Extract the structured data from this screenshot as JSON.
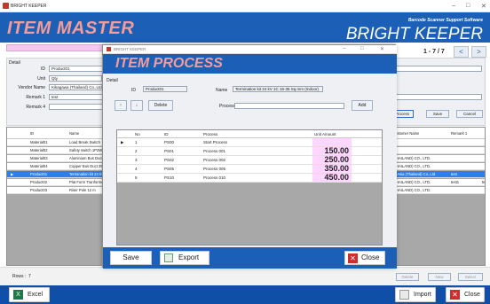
{
  "window": {
    "title": "BRIGHT KEEPER",
    "minimize": "–",
    "maximize": "□",
    "close": "✕"
  },
  "banner": {
    "title": "ITEM MASTER",
    "tagline": "Barcode Scanner Support Software",
    "brand": "BRIGHT KEEPER"
  },
  "detail": {
    "section": "Detail",
    "id_label": "ID",
    "id_value": "Product01",
    "unit_label": "Unit",
    "unit_value": "Qty",
    "vendor_label": "Vendor Name",
    "vendor_value": "Kikagawa (Thailand) Co.,Ltd.",
    "remark1_label": "Remark 1",
    "remark1_value": "test",
    "remark2_label": "Remark 4",
    "remark2_value": ""
  },
  "pager": {
    "text": "1 - 7 / 7",
    "prev": "<",
    "next": ">"
  },
  "actions": {
    "process": "Process",
    "save": "Save",
    "cancel": "Cancel"
  },
  "grid": {
    "headers": {
      "id": "ID",
      "name": "Name",
      "customer": "Customer Name",
      "remark": "Remark 1"
    },
    "rows": [
      {
        "id": "Material01",
        "name": "Load Break Switch",
        "customer": "",
        "remark": "",
        "extra": ""
      },
      {
        "id": "Material02",
        "name": "Safety switch 1P2W 4",
        "customer": "",
        "remark": "",
        "extra": ""
      },
      {
        "id": "Material03",
        "name": "Aluminium Bus Duct 3(",
        "customer": "(THAILAND) CO., LTD.",
        "remark": "",
        "extra": ""
      },
      {
        "id": "Material04",
        "name": "Copper Bus Duct 2500",
        "customer": "(THAILAND) CO., LTD.",
        "remark": "",
        "extra": ""
      },
      {
        "id": "Product01",
        "name": "Termination kit 24 kV",
        "customer": "ch Asia (Thailand) Co.,Ltd.",
        "remark": "test",
        "extra": ""
      },
      {
        "id": "Product02",
        "name": "Plat Form Tranformer 1",
        "customer": "(THAILAND) CO., LTD.",
        "remark": "test1",
        "extra": "te"
      },
      {
        "id": "Product03",
        "name": "Riser Pole 12 m",
        "customer": "(THAILAND) CO., LTD.",
        "remark": "",
        "extra": ""
      }
    ],
    "selected_index": 4
  },
  "status": {
    "rows_label": "Rows :",
    "rows_value": "7",
    "delete": "Delete",
    "new": "New",
    "select": "Select"
  },
  "bottom": {
    "excel": "Excel",
    "import": "Import",
    "close": "Close"
  },
  "modal": {
    "title": "BRIGHT KEEPER",
    "banner": "ITEM PROCESS",
    "section": "Detail",
    "id_label": "ID",
    "id_value": "Product01",
    "name_label": "Name",
    "name_value": "Termination kit 24 kV 1C 16-35 Sq.mm (Indoor)",
    "up": "↑",
    "down": "↓",
    "delete": "Delete",
    "process_label": "Process",
    "process_value": "",
    "add": "Add",
    "headers": {
      "no": "No",
      "id": "ID",
      "process": "Process",
      "amount": "Unit Amount"
    },
    "rows": [
      {
        "no": "1",
        "id": "PS00",
        "process": "Start Process",
        "amount": ""
      },
      {
        "no": "2",
        "id": "PS01",
        "process": "Process 001",
        "amount": "150.00"
      },
      {
        "no": "3",
        "id": "PS02",
        "process": "Process 002",
        "amount": "250.00"
      },
      {
        "no": "4",
        "id": "PS05",
        "process": "Process 005",
        "amount": "350.00"
      },
      {
        "no": "5",
        "id": "PS10",
        "process": "Process 010",
        "amount": "450.00"
      }
    ],
    "save": "Save",
    "export": "Export",
    "close": "Close"
  }
}
